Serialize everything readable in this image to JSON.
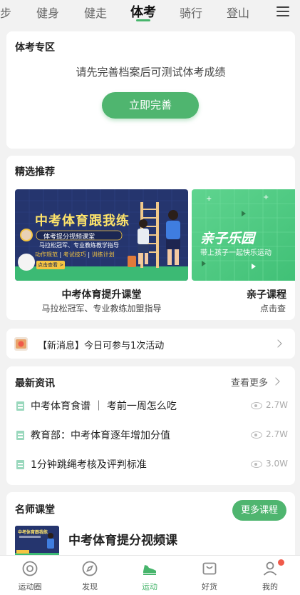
{
  "top_tabs": [
    "步",
    "健身",
    "健走",
    "体考",
    "骑行",
    "登山"
  ],
  "active_tab": "体考",
  "exam_section": {
    "title": "体考专区",
    "message": "请先完善档案后可测试体考成绩",
    "button": "立即完善"
  },
  "recommend": {
    "title": "精选推荐",
    "items": [
      {
        "title": "中考体育提升课堂",
        "subtitle": "马拉松冠军、专业教练加盟指导",
        "banner": {
          "headline": "中考体育跟我练",
          "sub": "体考提分视频课堂",
          "desc": "马拉松冠军、专业教练教学指导",
          "tags": [
            "动作规范",
            "考试技巧",
            "训练计划"
          ],
          "cta": "点击查看 >"
        }
      },
      {
        "title": "亲子课程",
        "subtitle": "点击查",
        "banner": {
          "headline": "亲子乐园",
          "sub": "带上孩子一起快乐运动"
        }
      }
    ]
  },
  "notice": {
    "text": "【新消息】今日可参与1次活动"
  },
  "news": {
    "title": "最新资讯",
    "more": "查看更多",
    "items": [
      {
        "title": "中考体育食谱 ｜ 考前一周怎么吃",
        "views": "2.7W"
      },
      {
        "title": "教育部：中考体育逐年增加分值",
        "views": "2.7W"
      },
      {
        "title": "1分钟跳绳考核及评判标准",
        "views": "3.0W"
      }
    ]
  },
  "teachers": {
    "title": "名师课堂",
    "more_button": "更多课程",
    "course_title": "中考体育提分视频课",
    "thumb_text": "中考体育跟我练"
  },
  "bottom_nav": [
    {
      "label": "运动圈",
      "icon": "sport-circle-icon"
    },
    {
      "label": "发现",
      "icon": "compass-icon"
    },
    {
      "label": "运动",
      "icon": "shoe-icon"
    },
    {
      "label": "好货",
      "icon": "shop-bag-icon"
    },
    {
      "label": "我的",
      "icon": "user-icon"
    }
  ],
  "colors": {
    "accent": "#4fb56f",
    "background": "#f2f2f2",
    "badge": "#f05a4a"
  }
}
